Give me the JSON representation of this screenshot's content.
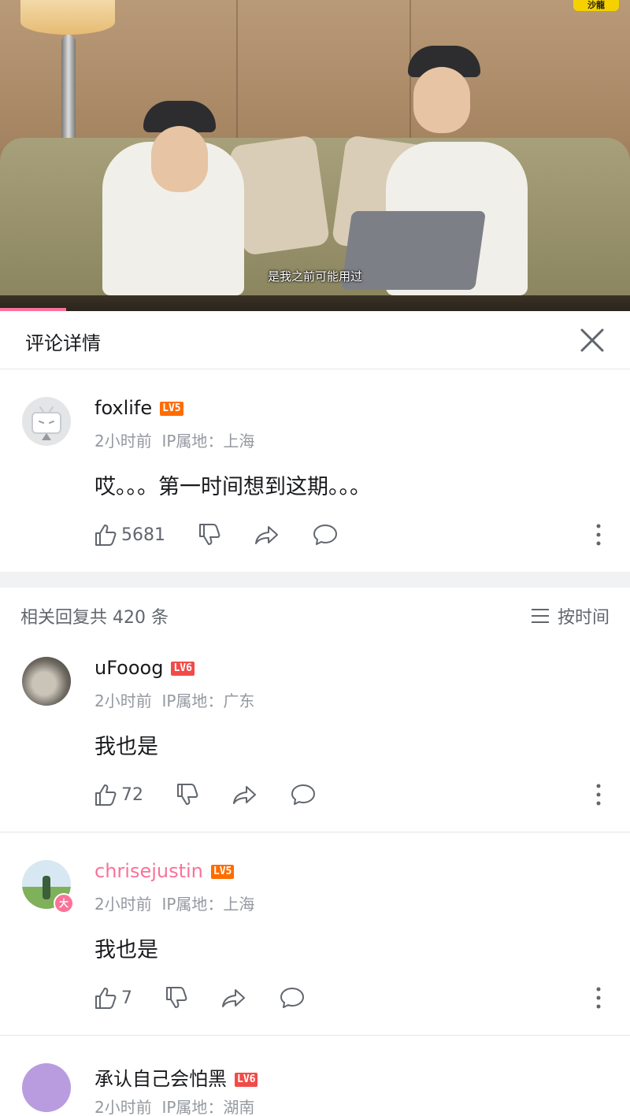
{
  "video": {
    "subtitle": "是我之前可能用过",
    "watermark": "沙龍",
    "progress_fraction": 0.105
  },
  "panel": {
    "title": "评论详情"
  },
  "root_comment": {
    "username": "foxlife",
    "level": "LV5",
    "time": "2小时前",
    "location": "IP属地：上海",
    "text": "哎。。。第一时间想到这期。。。",
    "likes": "5681"
  },
  "replies_header": {
    "summary": "相关回复共 420 条",
    "sort_label": "按时间"
  },
  "replies": [
    {
      "username": "uFooog",
      "level": "LV6",
      "time": "2小时前",
      "location": "IP属地：广东",
      "text": "我也是",
      "likes": "72"
    },
    {
      "username": "chrisejustin",
      "level": "LV5",
      "time": "2小时前",
      "location": "IP属地：上海",
      "text": "我也是",
      "likes": "7",
      "avatar_badge": "大"
    },
    {
      "username": "承认自己会怕黑",
      "level": "LV6",
      "time": "2小时前",
      "location": "IP属地：湖南"
    }
  ],
  "colors": {
    "accent_pink": "#fb7299",
    "lv5": "#ff6c00",
    "lv6": "#f04c49",
    "muted": "#9499a0"
  }
}
